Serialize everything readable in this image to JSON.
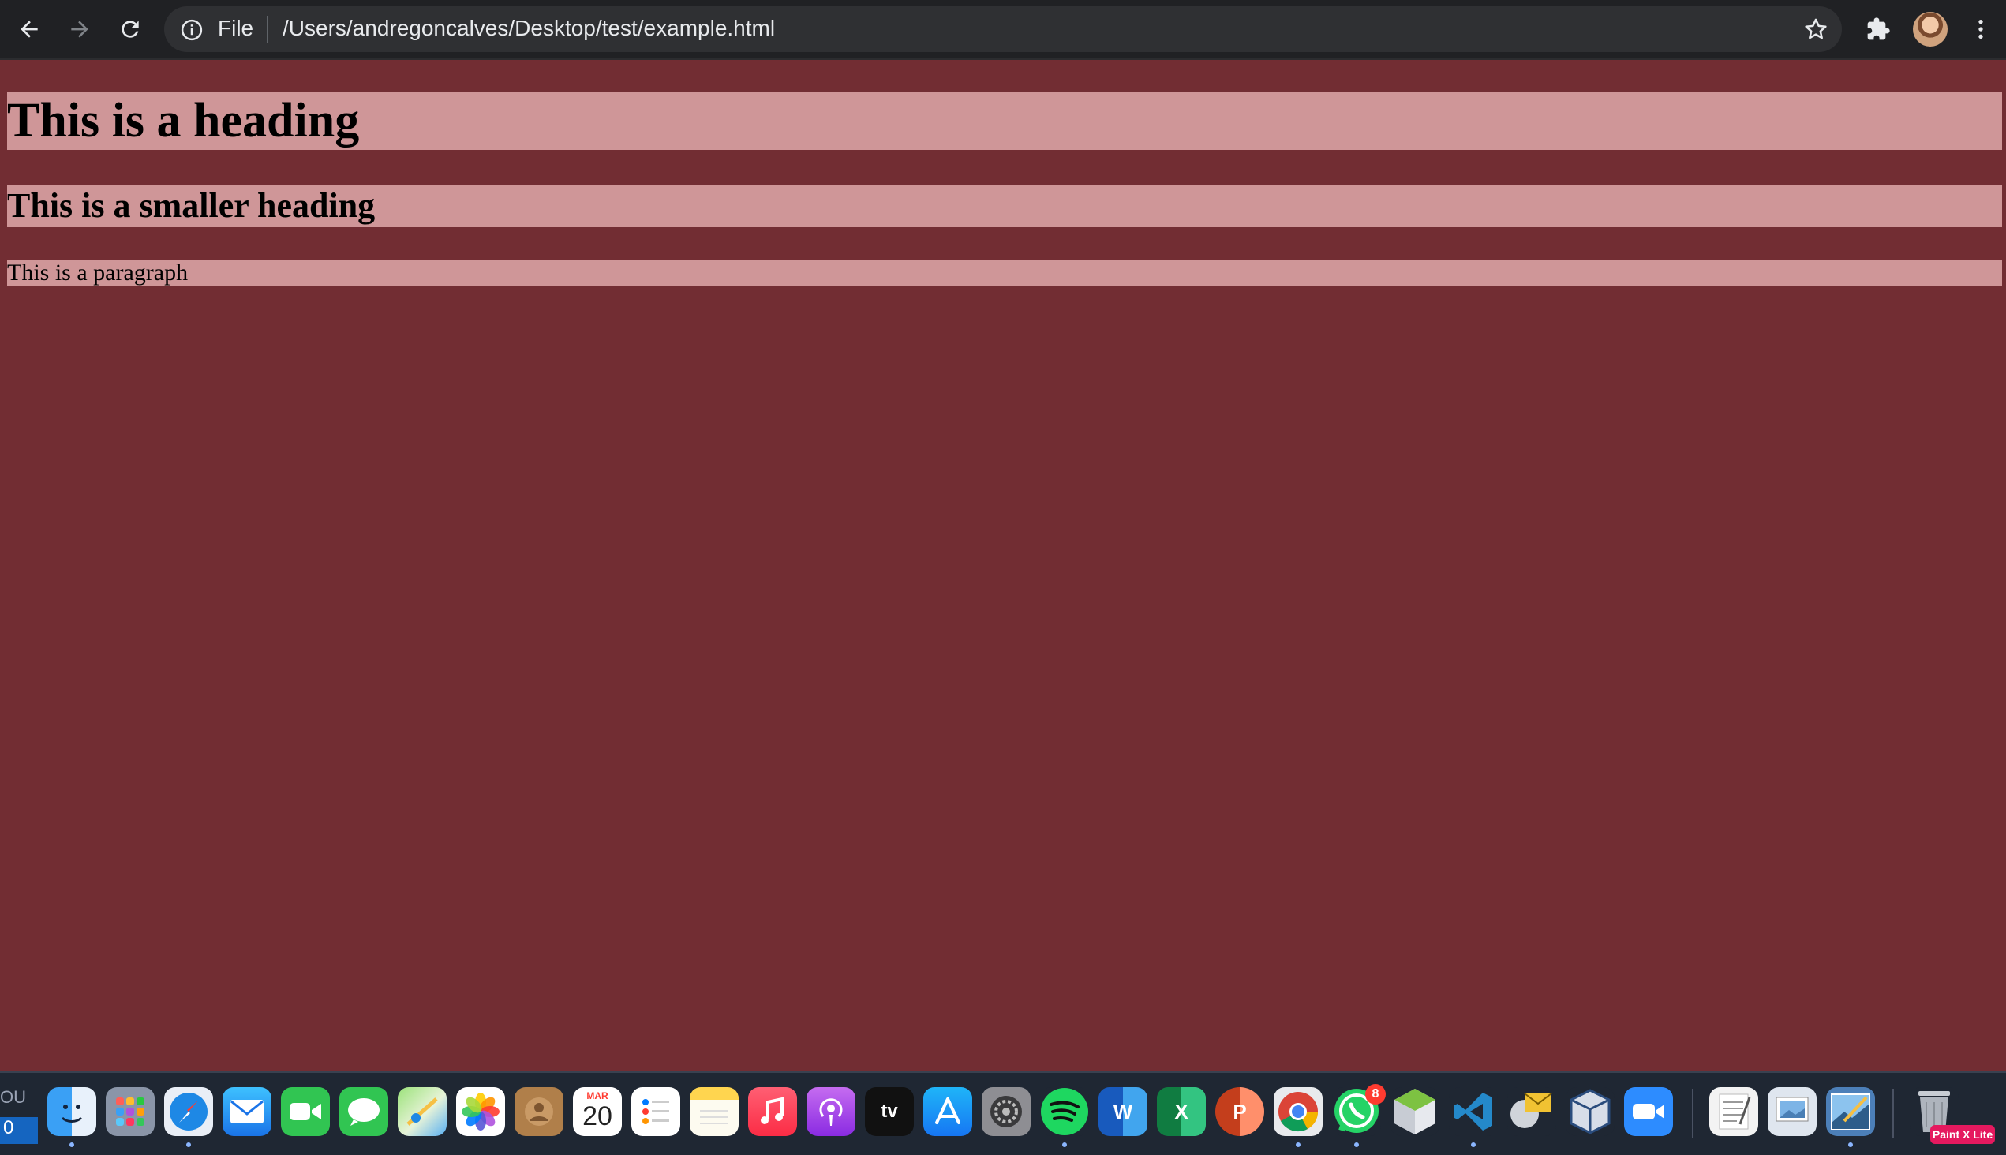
{
  "browser": {
    "scheme_label": "File",
    "url": "/Users/andregoncalves/Desktop/test/example.html"
  },
  "page": {
    "heading": "This is a heading",
    "smaller_heading": "This is a smaller heading",
    "paragraph": "This is a paragraph"
  },
  "colors": {
    "page_background": "#722d33",
    "block_background": "#cf9698",
    "toolbar_background": "#202124"
  },
  "dock": {
    "left_label": "OU",
    "left_count": "0",
    "calendar_month": "MAR",
    "calendar_day": "20",
    "whatsapp_badge": "8",
    "word_letter": "W",
    "excel_letter": "X",
    "powerpoint_letter": "P",
    "tv_label": "tv",
    "paint_tag": "Paint X Lite",
    "apps": [
      "finder-icon",
      "launchpad-icon",
      "safari-icon",
      "mail-icon",
      "facetime-icon",
      "messages-icon",
      "maps-icon",
      "photos-icon",
      "contacts-icon",
      "calendar-icon",
      "reminders-icon",
      "notes-icon",
      "music-icon",
      "podcasts-icon",
      "apple-tv-icon",
      "app-store-icon",
      "system-preferences-icon",
      "spotify-icon",
      "word-icon",
      "excel-icon",
      "powerpoint-icon",
      "chrome-icon",
      "whatsapp-icon",
      "sketchup-icon",
      "vscode-icon",
      "app-icon",
      "virtualbox-icon",
      "zoom-icon",
      "textedit-icon",
      "preview-icon",
      "paint-x-icon",
      "trash-icon"
    ]
  }
}
